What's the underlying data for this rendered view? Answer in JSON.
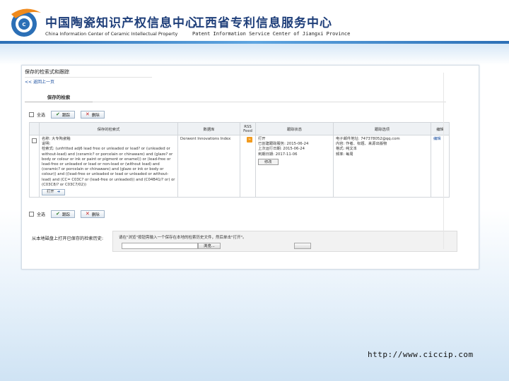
{
  "header": {
    "cn_left": "中国陶瓷知识产权信息中心",
    "en_left": "China Information Center of Ceramic Intellectual Property",
    "cn_right": "江西省专利信息服务中心",
    "en_right": "Patent Information Service Center of  Jiangxi  Province"
  },
  "page": {
    "heading": "保存的检索式和跟踪",
    "back_link": "<< 返回上一页",
    "tab_saved": "保存的检索"
  },
  "toolbar": {
    "select_all": "全选",
    "track_btn": "跟踪",
    "delete_btn": "删除"
  },
  "table": {
    "headers": [
      "",
      "保存的检索式",
      "数据库",
      "RSS Feed",
      "跟踪状态",
      "跟踪选项",
      "编辑"
    ],
    "row": {
      "name_label": "名称: 大专陶瓷釉",
      "desc_label": "说明:",
      "query": "检索式: (unfritted adj6 lead free or unleaded or lead? or (unleaded or without-lead) and (ceramic? or porcelain or chinaware) and (glaze? or body or colour or ink or paint or pigment or enamel)) or (lead-free or lead-free or unleaded or lead or non-lead or (without lead) and (ceramic? or porcelain or chinaware) and (glaze or ink or body or colour)) and ((lead-free or unleaded or lead or unleaded or without-lead) and (CC= C03C? or (lead-free or unleaded)) and (C04B41/? or) or (C03C8/? or C03C7/02))",
      "open_btn": "打开",
      "database": "Derwent Innovations Index",
      "tracking_status": [
        "打开",
        "已创建跟踪服务: 2015-06-24",
        "上次运行日期: 2015-06-24",
        "到期日期: 2017-11-06"
      ],
      "modify_btn": "修改",
      "tracking_options": [
        "电子邮件地址: 747378052@qq.com",
        "内容: 作者、标题、来源出版物",
        "格式: 纯文本",
        "频率: 每周"
      ],
      "edit_link": "编辑"
    }
  },
  "import": {
    "label": "从本地磁盘上打开已保存的检索历史:",
    "hint": "请在\"浏览\"按钮旁输入一个保存在本地的检索历史文件，然后单击\"打开\"。",
    "browse_btn": "浏览..."
  },
  "footer": {
    "url": "http://www.ciccip.com"
  },
  "colors": {
    "brand": "#1f3f7a",
    "accent_band": "#2b6fb6",
    "link": "#1a4fa0",
    "rss": "#f29b1f"
  }
}
